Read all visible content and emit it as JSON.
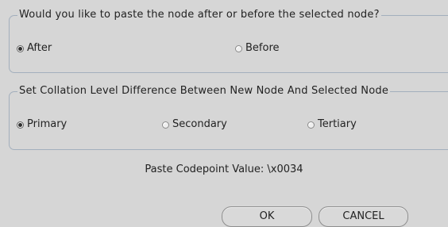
{
  "paste_position": {
    "legend": "Would you like to paste the node after or before the selected node?",
    "options": [
      {
        "label": "After",
        "checked": true
      },
      {
        "label": "Before",
        "checked": false
      }
    ]
  },
  "collation": {
    "legend": "Set Collation Level Difference Between New Node And Selected Node",
    "options": [
      {
        "label": "Primary",
        "checked": true
      },
      {
        "label": "Secondary",
        "checked": false
      },
      {
        "label": "Tertiary",
        "checked": false
      }
    ]
  },
  "codepoint_text": "Paste Codepoint Value: \\x0034",
  "buttons": {
    "ok_label": "OK",
    "cancel_label": "CANCEL"
  }
}
